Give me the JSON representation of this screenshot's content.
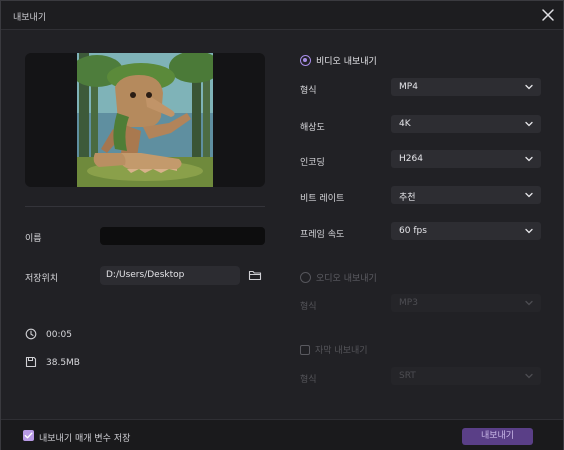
{
  "window": {
    "title": "내보내기"
  },
  "left": {
    "name_label": "이름",
    "name_value": "",
    "location_label": "저장위치",
    "location_value": "D:/Users/Desktop",
    "duration": "00:05",
    "size": "38.5MB"
  },
  "video": {
    "toggle_label": "비디오 내보내기",
    "selected": true,
    "fields": [
      {
        "label": "형식",
        "value": "MP4"
      },
      {
        "label": "해상도",
        "value": "4K"
      },
      {
        "label": "인코딩",
        "value": "H264"
      },
      {
        "label": "비트 레이트",
        "value": "추천"
      },
      {
        "label": "프레임 속도",
        "value": "60  fps"
      }
    ]
  },
  "audio": {
    "toggle_label": "오디오 내보내기",
    "selected": false,
    "format_label": "형식",
    "format_value": "MP3"
  },
  "subtitle": {
    "toggle_label": "자막 내보내기",
    "checked": false,
    "format_label": "형식",
    "format_value": "SRT"
  },
  "footer": {
    "remember_label": "내보내기 매개 변수 저장",
    "remember_checked": true,
    "export_button": "내보내기"
  },
  "colors": {
    "accent": "#a68ce6",
    "export_button_bg": "#5a3f87",
    "window_bg": "#212125"
  }
}
